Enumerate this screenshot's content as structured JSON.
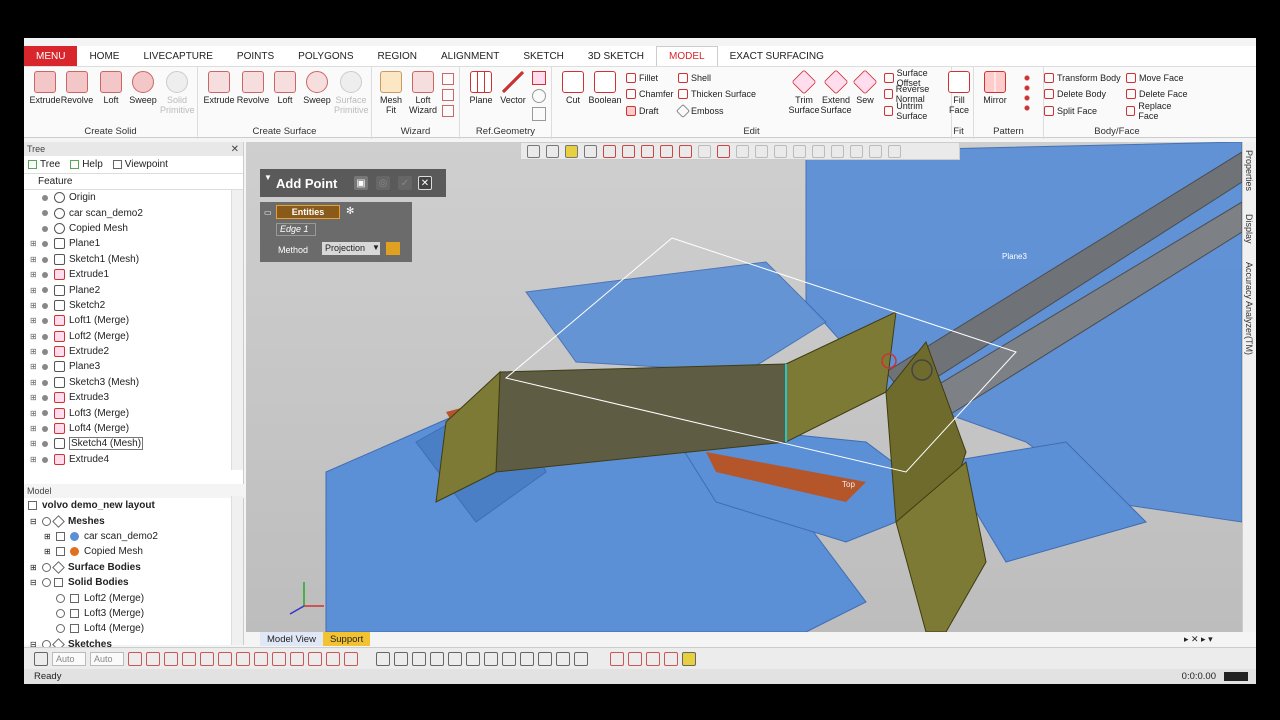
{
  "menubar": {
    "tabs": [
      "MENU",
      "HOME",
      "LIVECAPTURE",
      "POINTS",
      "POLYGONS",
      "REGION",
      "ALIGNMENT",
      "SKETCH",
      "3D SKETCH",
      "MODEL",
      "EXACT SURFACING"
    ],
    "active": "MODEL"
  },
  "ribbon": {
    "create_solid": {
      "name": "Create Solid",
      "buttons": [
        "Extrude",
        "Revolve",
        "Loft",
        "Sweep",
        "Solid Primitive"
      ]
    },
    "create_surface": {
      "name": "Create Surface",
      "buttons": [
        "Extrude",
        "Revolve",
        "Loft",
        "Sweep",
        "Surface Primitive"
      ]
    },
    "wizard": {
      "name": "Wizard",
      "buttons": [
        "Mesh Fit",
        "Loft Wizard"
      ]
    },
    "ref_geometry": {
      "name": "Ref.Geometry",
      "buttons": [
        "Plane",
        "Vector"
      ]
    },
    "edit": {
      "name": "Edit",
      "buttons": [
        "Cut",
        "Boolean"
      ],
      "small": [
        "Fillet",
        "Chamfer",
        "Draft",
        "Shell",
        "Thicken Surface",
        "Emboss",
        "Trim Surface",
        "Extend Surface",
        "Sew",
        "Surface Offset",
        "Reverse Normal",
        "Untrim Surface"
      ]
    },
    "fit": {
      "name": "Fit",
      "buttons": [
        "Fill Face"
      ]
    },
    "pattern": {
      "name": "Pattern",
      "buttons": [
        "Mirror"
      ]
    },
    "body_face": {
      "name": "Body/Face",
      "small": [
        "Transform Body",
        "Delete Body",
        "Split Face",
        "Move Face",
        "Delete Face",
        "Replace Face"
      ]
    }
  },
  "tree_panel": {
    "title": "Tree",
    "tabs": [
      "Tree",
      "Help",
      "Viewpoint"
    ],
    "header": "Feature",
    "items": [
      "Origin",
      "car scan_demo2",
      "Copied Mesh",
      "Plane1",
      "Sketch1 (Mesh)",
      "Extrude1",
      "Plane2",
      "Sketch2",
      "Loft1 (Merge)",
      "Loft2 (Merge)",
      "Extrude2",
      "Plane3",
      "Sketch3 (Mesh)",
      "Extrude3",
      "Loft3 (Merge)",
      "Loft4 (Merge)",
      "Sketch4 (Mesh)",
      "Extrude4"
    ],
    "selected": "Sketch4 (Mesh)"
  },
  "model_panel": {
    "title": "Model",
    "root": "volvo demo_new layout",
    "meshes": "Meshes",
    "mesh_items": [
      "car scan_demo2",
      "Copied Mesh"
    ],
    "surface_bodies": "Surface Bodies",
    "solid_bodies": "Solid Bodies",
    "solid_items": [
      "Loft2 (Merge)",
      "Loft3 (Merge)",
      "Loft4 (Merge)"
    ],
    "sketches": "Sketches"
  },
  "add_point": {
    "title": "Add Point",
    "entities_label": "Entities",
    "entity_value": "Edge 1",
    "method_label": "Method",
    "method_value": "Projection"
  },
  "viewport": {
    "plane_label": "Plane3",
    "top_label": "Top"
  },
  "view_tabs": [
    "Model View",
    "Support"
  ],
  "bottom": {
    "auto1": "Auto",
    "auto2": "Auto"
  },
  "status": {
    "left": "Ready",
    "right": "0:0:0.00"
  },
  "right_panels": [
    "Properties",
    "Display",
    "Accuracy Analyzer(TM)"
  ],
  "colors": {
    "menu_red": "#d9262c",
    "mesh_blue": "#5b8fd6",
    "surface_olive": "#7d7a35",
    "support_tab": "#f2c230"
  }
}
